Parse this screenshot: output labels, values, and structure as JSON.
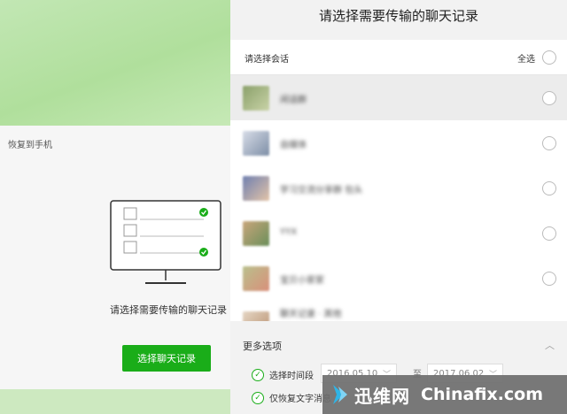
{
  "left": {
    "title": "恢复到手机",
    "caption": "请选择需要传输的聊天记录",
    "button_label": "选择聊天记录"
  },
  "panel": {
    "title": "请选择需要传输的聊天记录",
    "list_header": "请选择会话",
    "select_all": "全选",
    "items": [
      {
        "name": "闲话群",
        "selected": true
      },
      {
        "name": "自媒体",
        "selected": false
      },
      {
        "name": "学习交流分享群 包头",
        "selected": false
      },
      {
        "name": "YYX",
        "selected": false
      },
      {
        "name": "宝贝小家家",
        "selected": false
      },
      {
        "name": "聊天记录 · 其他",
        "selected": false
      }
    ],
    "more": {
      "title": "更多选项",
      "opt_time": "选择时间段",
      "opt_text": "仅恢复文字消息",
      "date_from": "2016.05.10",
      "date_to_sep": "至",
      "date_to": "2017.06.02"
    }
  },
  "watermark": {
    "cn": "迅维网",
    "en": "Chinafix.com"
  },
  "colors": {
    "accent": "#1aad19"
  }
}
